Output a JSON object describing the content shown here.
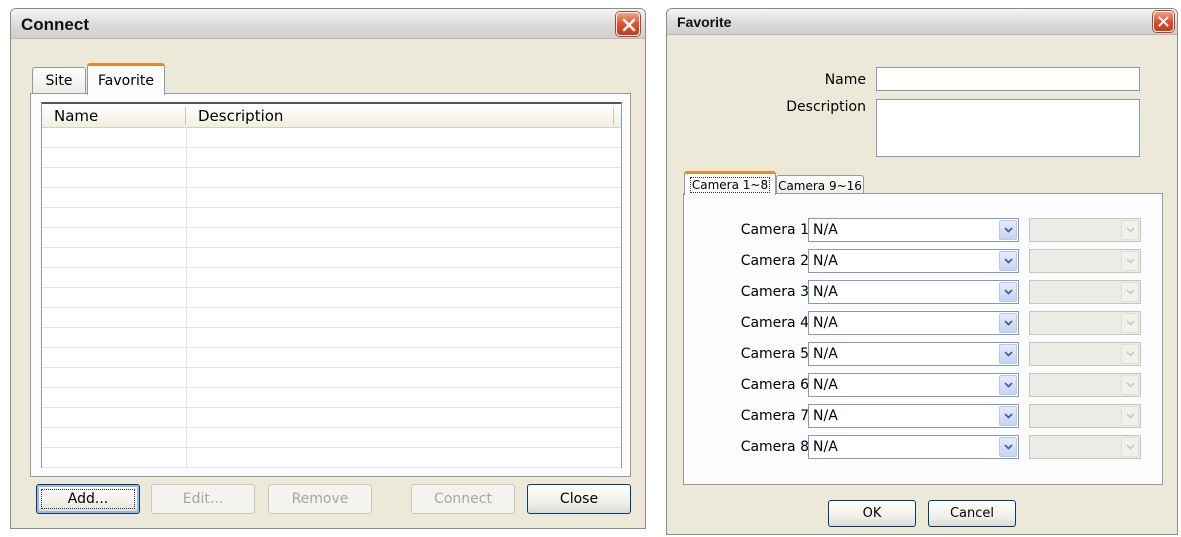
{
  "connect": {
    "title": "Connect",
    "tabs": {
      "site": "Site",
      "favorite": "Favorite"
    },
    "columns": {
      "name": "Name",
      "description": "Description"
    },
    "buttons": {
      "add": "Add...",
      "edit": "Edit...",
      "remove": "Remove",
      "connect": "Connect",
      "close": "Close"
    }
  },
  "favorite": {
    "title": "Favorite",
    "name_label": "Name",
    "name_value": "",
    "description_label": "Description",
    "description_value": "",
    "tabs": {
      "cam1_8": "Camera 1~8",
      "cam9_16": "Camera 9~16"
    },
    "cameras": [
      {
        "label": "Camera 1",
        "value": "N/A"
      },
      {
        "label": "Camera 2",
        "value": "N/A"
      },
      {
        "label": "Camera 3",
        "value": "N/A"
      },
      {
        "label": "Camera 4",
        "value": "N/A"
      },
      {
        "label": "Camera 5",
        "value": "N/A"
      },
      {
        "label": "Camera 6",
        "value": "N/A"
      },
      {
        "label": "Camera 7",
        "value": "N/A"
      },
      {
        "label": "Camera 8",
        "value": "N/A"
      }
    ],
    "buttons": {
      "ok": "OK",
      "cancel": "Cancel"
    }
  },
  "colors": {
    "close_red": "#e0502c",
    "tab_accent": "#e68b2c",
    "dialog_bg": "#ece9d8"
  }
}
